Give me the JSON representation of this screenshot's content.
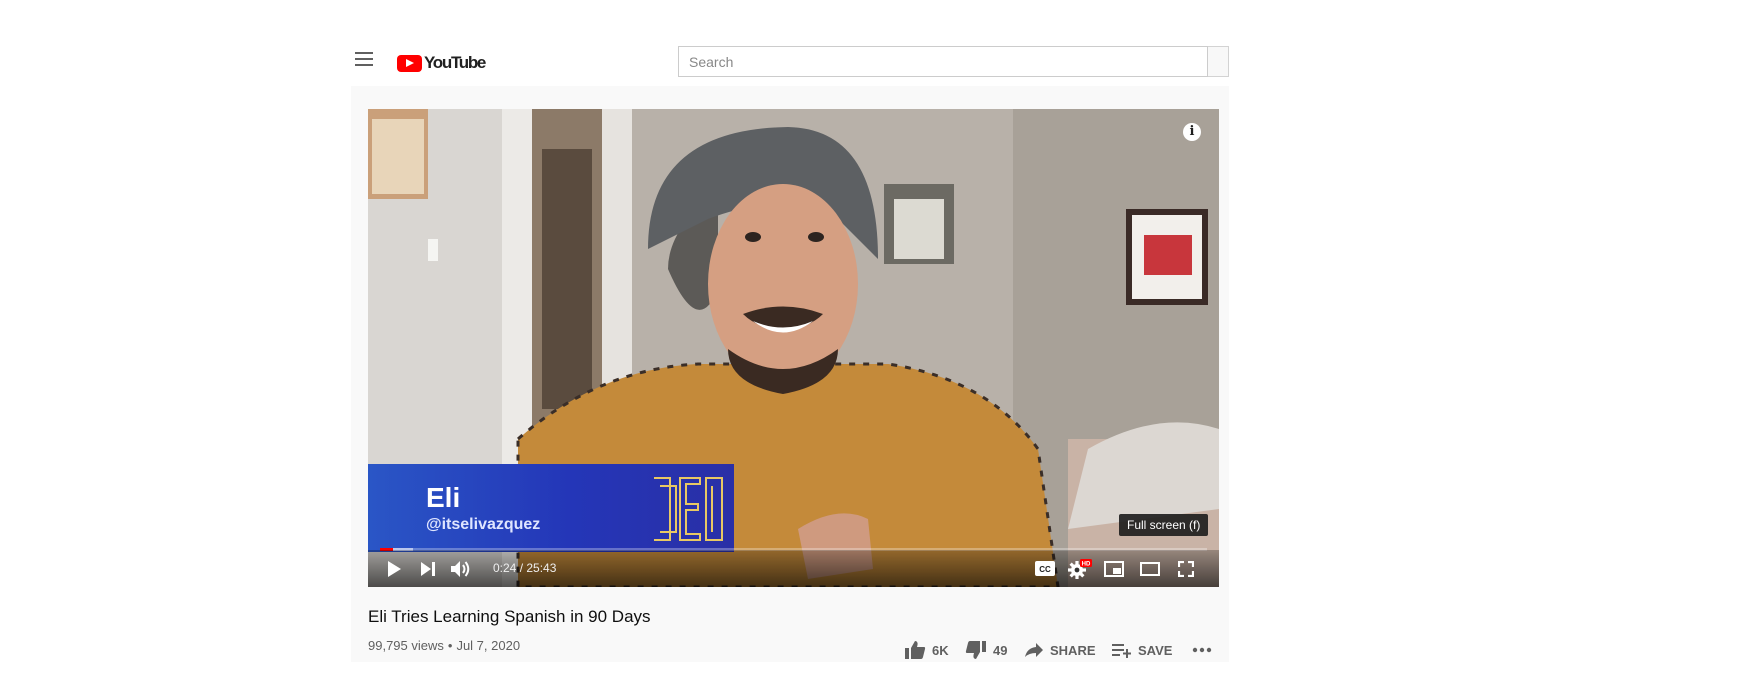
{
  "masthead": {
    "logo_text": "YouTube",
    "search_placeholder": "Search"
  },
  "player": {
    "lower_third": {
      "name": "Eli",
      "handle": "@itselivazquez"
    },
    "time": "0:24 / 25:43",
    "progress_played": 0.016,
    "progress_loaded": 0.04,
    "tooltip": "Full screen (f)",
    "settings_badge": "HD",
    "brand_color": "#ff0000"
  },
  "video": {
    "title": "Eli Tries Learning Spanish in 90 Days",
    "views": "99,795 views",
    "date": "Jul 7, 2020"
  },
  "actions": {
    "likes": "6K",
    "dislikes": "49",
    "share_label": "SHARE",
    "save_label": "SAVE"
  },
  "icons": [
    "menu-icon",
    "youtube-logo-icon",
    "search-icon",
    "info-icon",
    "play-icon",
    "next-icon",
    "volume-icon",
    "captions-icon",
    "settings-icon",
    "miniplayer-icon",
    "theater-icon",
    "fullscreen-icon",
    "thumbs-up-icon",
    "thumbs-down-icon",
    "share-icon",
    "add-to-playlist-icon",
    "more-icon"
  ]
}
